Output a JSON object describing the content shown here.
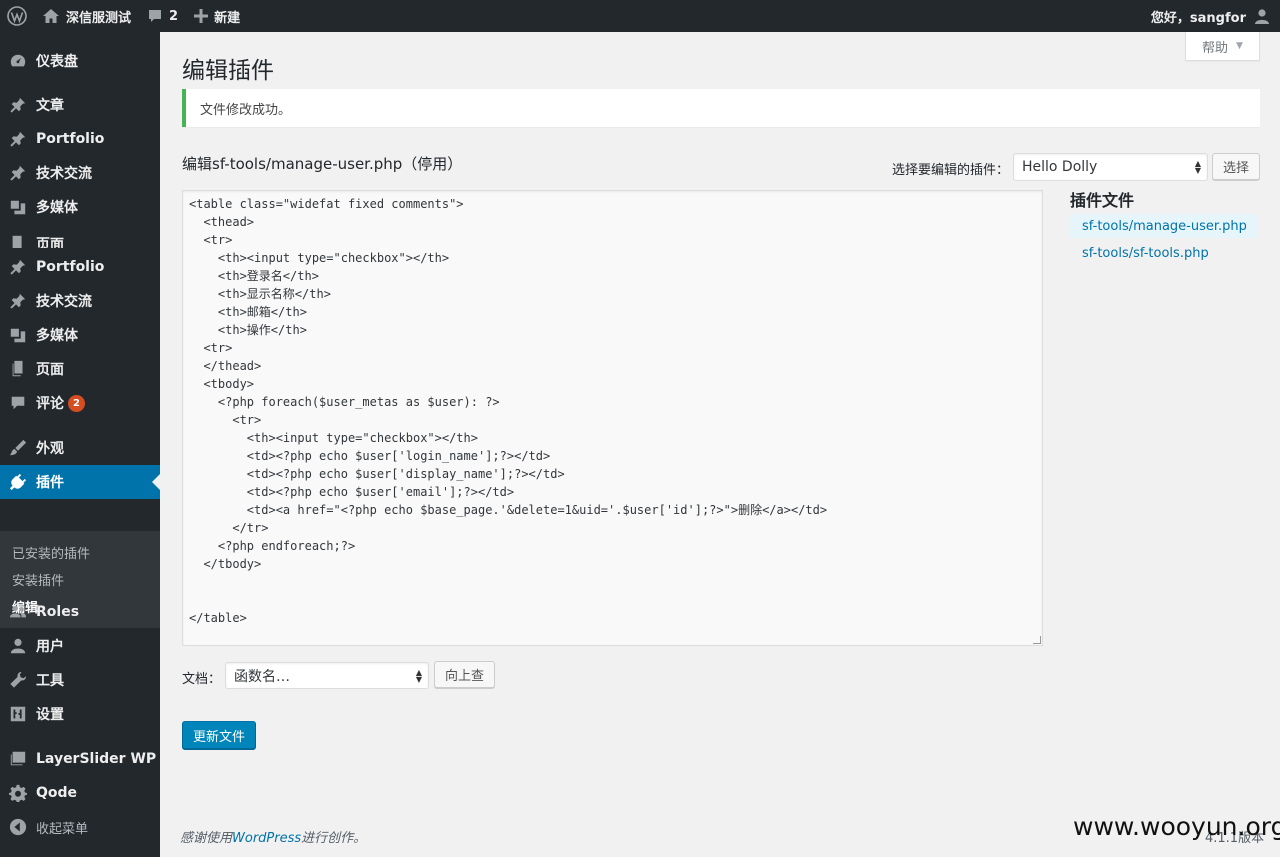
{
  "adminbar": {
    "site_name": "深信服测试",
    "comments_count": "2",
    "new_label": "新建",
    "greeting": "您好，sangfor"
  },
  "sidebar": {
    "items": [
      {
        "label": "仪表盘",
        "icon": "dashboard-icon"
      },
      {
        "label": "文章",
        "icon": "pin-icon"
      },
      {
        "label": "Portfolio",
        "icon": "pin-icon"
      },
      {
        "label": "技术交流",
        "icon": "pin-icon"
      },
      {
        "label": "多媒体",
        "icon": "media-icon"
      },
      {
        "label": "页面",
        "icon": "page-icon"
      },
      {
        "label": "Portfolio",
        "icon": "pin-icon"
      },
      {
        "label": "技术交流",
        "icon": "pin-icon"
      },
      {
        "label": "多媒体",
        "icon": "media-icon"
      },
      {
        "label": "页面",
        "icon": "page-icon"
      },
      {
        "label": "评论",
        "icon": "comment-icon",
        "badge": "2"
      },
      {
        "label": "外观",
        "icon": "brush-icon"
      },
      {
        "label": "插件",
        "icon": "plugin-icon"
      },
      {
        "label": "Roles",
        "icon": "users-icon"
      },
      {
        "label": "用户",
        "icon": "user-icon"
      },
      {
        "label": "工具",
        "icon": "wrench-icon"
      },
      {
        "label": "设置",
        "icon": "settings-icon"
      },
      {
        "label": "LayerSlider WP",
        "icon": "layers-icon"
      },
      {
        "label": "Qode",
        "icon": "gear-icon"
      }
    ],
    "submenu": [
      "已安装的插件",
      "安装插件",
      "编辑"
    ],
    "collapse_label": "收起菜单"
  },
  "help_label": "帮助",
  "page_title": "编辑插件",
  "notice": "文件修改成功。",
  "file_heading": "编辑sf-tools/manage-user.php（停用）",
  "plugin_select": {
    "label": "选择要编辑的插件：",
    "value": "Hello Dolly",
    "button": "选择"
  },
  "code": "<table class=\"widefat fixed comments\">\n  <thead>\n  <tr>\n    <th><input type=\"checkbox\"></th>\n    <th>登录名</th>\n    <th>显示名称</th>\n    <th>邮箱</th>\n    <th>操作</th>\n  <tr>\n  </thead>\n  <tbody>\n    <?php foreach($user_metas as $user): ?>\n      <tr>\n        <th><input type=\"checkbox\"></th>\n        <td><?php echo $user['login_name'];?></td>\n        <td><?php echo $user['display_name'];?></td>\n        <td><?php echo $user['email'];?></td>\n        <td><a href=\"<?php echo $base_page.'&delete=1&uid='.$user['id'];?>\">删除</a></td>\n      </tr>\n    <?php endforeach;?>\n  </tbody>\n\n\n</table>",
  "plugin_files": {
    "title": "插件文件",
    "files": [
      "sf-tools/manage-user.php",
      "sf-tools/sf-tools.php"
    ]
  },
  "docs": {
    "label": "文档：",
    "select_value": "函数名…",
    "button": "向上查"
  },
  "update_button": "更新文件",
  "footer": {
    "thanks_prefix": "感谢使用",
    "thanks_link": "WordPress",
    "thanks_suffix": "进行创作。",
    "version": "4.1.1版本"
  },
  "watermark": "www.wooyun.org"
}
